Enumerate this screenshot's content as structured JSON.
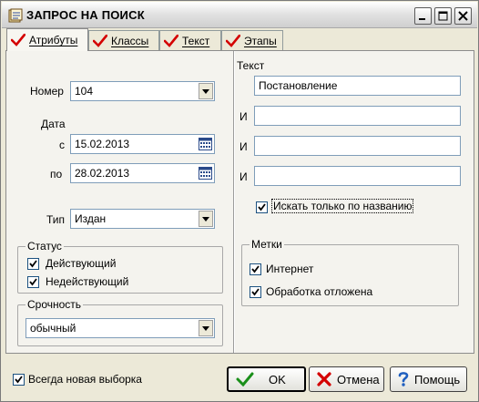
{
  "window": {
    "title": "ЗАПРОС НА ПОИСК"
  },
  "tabs": [
    {
      "label": "Атрибуты",
      "checked": true,
      "active": true
    },
    {
      "label": "Классы",
      "checked": true,
      "active": false
    },
    {
      "label": "Текст",
      "checked": true,
      "active": false
    },
    {
      "label": "Этапы",
      "checked": true,
      "active": false
    }
  ],
  "attributes": {
    "number_label": "Номер",
    "number_value": "104",
    "date_label": "Дата",
    "from_label": "с",
    "from_value": "15.02.2013",
    "to_label": "по",
    "to_value": "28.02.2013",
    "type_label": "Тип",
    "type_value": "Издан"
  },
  "status": {
    "title": "Статус",
    "items": [
      {
        "label": "Действующий",
        "checked": true
      },
      {
        "label": "Недействующий",
        "checked": true
      }
    ]
  },
  "urgency": {
    "title": "Срочность",
    "value": "обычный"
  },
  "text_search": {
    "title": "Текст",
    "fields": [
      {
        "prefix": "",
        "value": "Постановление"
      },
      {
        "prefix": "И",
        "value": ""
      },
      {
        "prefix": "И",
        "value": ""
      },
      {
        "prefix": "И",
        "value": ""
      }
    ],
    "title_only_label": "Искать только по названию",
    "title_only_checked": true
  },
  "marks": {
    "title": "Метки",
    "items": [
      {
        "label": "Интернет",
        "checked": true
      },
      {
        "label": "Обработка отложена",
        "checked": true
      }
    ]
  },
  "footer": {
    "always_new_label": "Всегда новая выборка",
    "always_new_checked": true,
    "ok_label": "OK",
    "cancel_label": "Отмена",
    "help_label": "Помощь"
  },
  "colors": {
    "check_red": "#d40000",
    "check_green": "#1a8f1a",
    "help_blue": "#1f5fbf"
  }
}
